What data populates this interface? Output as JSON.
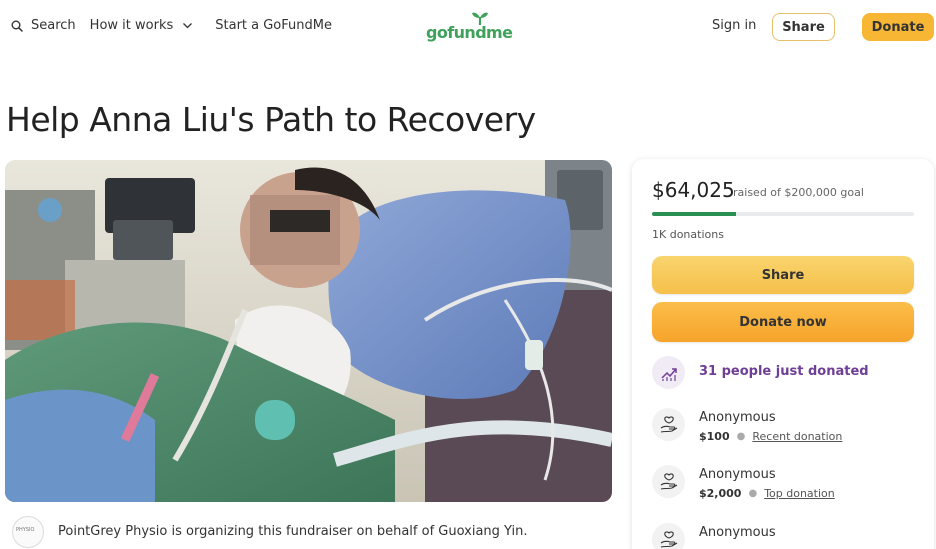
{
  "nav": {
    "search_label": "Search",
    "how_it_works_label": "How it works",
    "start_label": "Start a GoFundMe",
    "logo_text": "gofundme",
    "sign_in_label": "Sign in",
    "share_label": "Share",
    "donate_label": "Donate"
  },
  "page": {
    "title": "Help Anna Liu's Path to Recovery"
  },
  "organizer": {
    "avatar_text": "PHYSIO",
    "text": "PointGrey Physio is organizing this fundraiser on behalf of Guoxiang Yin."
  },
  "card": {
    "raised": "$64,025",
    "goal_text": "raised of $200,000 goal",
    "progress_fraction": 0.32,
    "donations_count": "1K donations",
    "share_label": "Share",
    "donate_now_label": "Donate now",
    "recent_activity": "31 people just donated",
    "donors": [
      {
        "name": "Anonymous",
        "amount": "$100",
        "label": "Recent donation"
      },
      {
        "name": "Anonymous",
        "amount": "$2,000",
        "label": "Top donation"
      },
      {
        "name": "Anonymous",
        "amount": "",
        "label": ""
      }
    ]
  },
  "colors": {
    "brand_green": "#3fa25a",
    "donate_yellow": "#f7b634",
    "progress_green": "#2a8f52",
    "activity_purple": "#6f3f95"
  }
}
